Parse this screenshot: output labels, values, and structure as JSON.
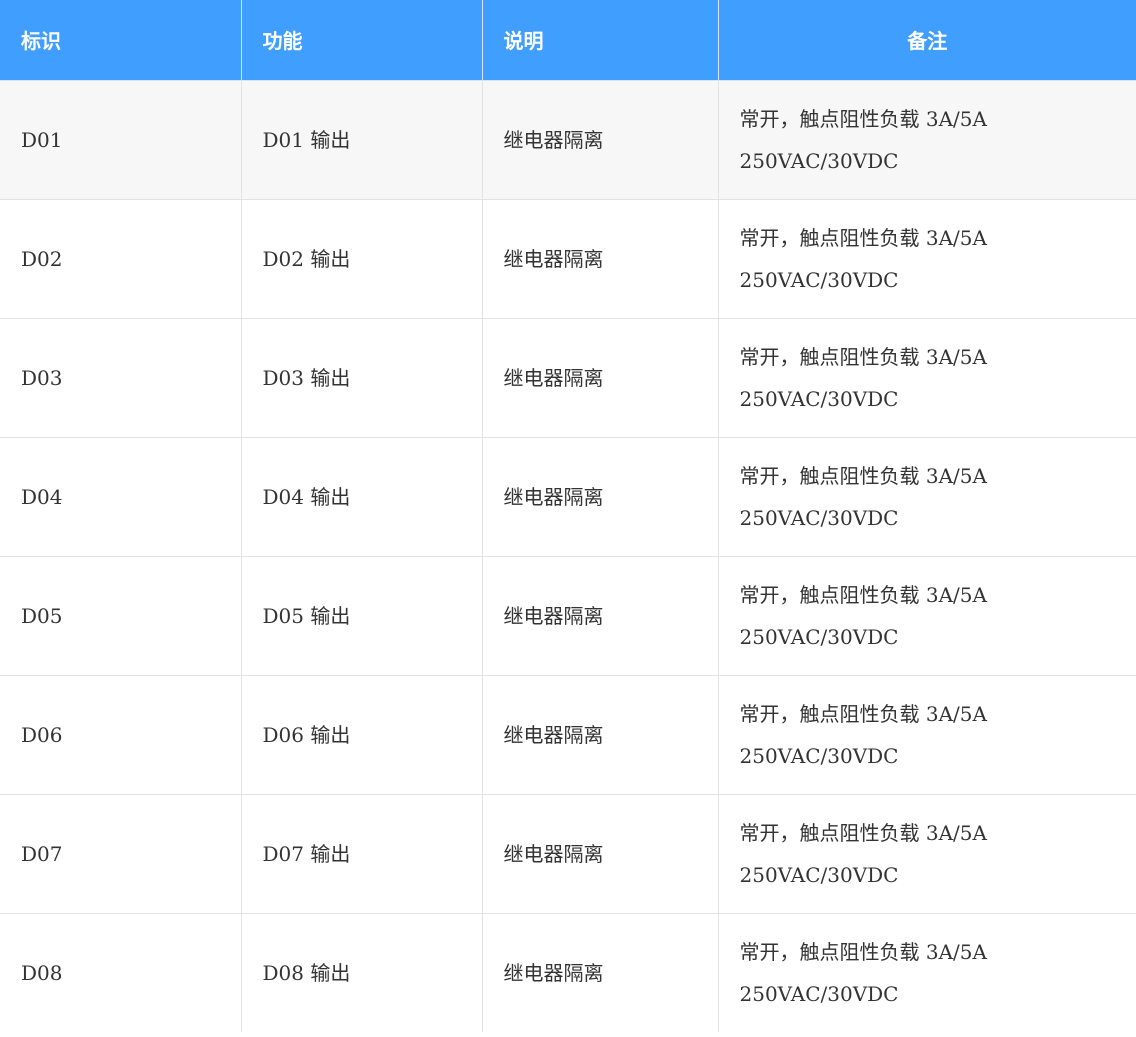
{
  "table": {
    "headers": [
      "标识",
      "功能",
      "说明",
      "备注"
    ],
    "rows": [
      {
        "id": "D01",
        "function": "D01 输出",
        "description": "继电器隔离",
        "note_line1": "常开，触点阻性负载 3A/5A",
        "note_line2": "250VAC/30VDC"
      },
      {
        "id": "D02",
        "function": "D02 输出",
        "description": "继电器隔离",
        "note_line1": "常开，触点阻性负载 3A/5A",
        "note_line2": "250VAC/30VDC"
      },
      {
        "id": "D03",
        "function": "D03 输出",
        "description": "继电器隔离",
        "note_line1": "常开，触点阻性负载 3A/5A",
        "note_line2": "250VAC/30VDC"
      },
      {
        "id": "D04",
        "function": "D04 输出",
        "description": "继电器隔离",
        "note_line1": "常开，触点阻性负载 3A/5A",
        "note_line2": "250VAC/30VDC"
      },
      {
        "id": "D05",
        "function": "D05 输出",
        "description": "继电器隔离",
        "note_line1": "常开，触点阻性负载 3A/5A",
        "note_line2": "250VAC/30VDC"
      },
      {
        "id": "D06",
        "function": "D06 输出",
        "description": "继电器隔离",
        "note_line1": "常开，触点阻性负载 3A/5A",
        "note_line2": "250VAC/30VDC"
      },
      {
        "id": "D07",
        "function": "D07 输出",
        "description": "继电器隔离",
        "note_line1": "常开，触点阻性负载 3A/5A",
        "note_line2": "250VAC/30VDC"
      },
      {
        "id": "D08",
        "function": "D08 输出",
        "description": "继电器隔离",
        "note_line1": "常开，触点阻性负载 3A/5A",
        "note_line2": "250VAC/30VDC"
      }
    ]
  },
  "colors": {
    "header_bg": "#409eff",
    "header_text": "#ffffff",
    "alt_row_bg": "#f7f7f7"
  }
}
